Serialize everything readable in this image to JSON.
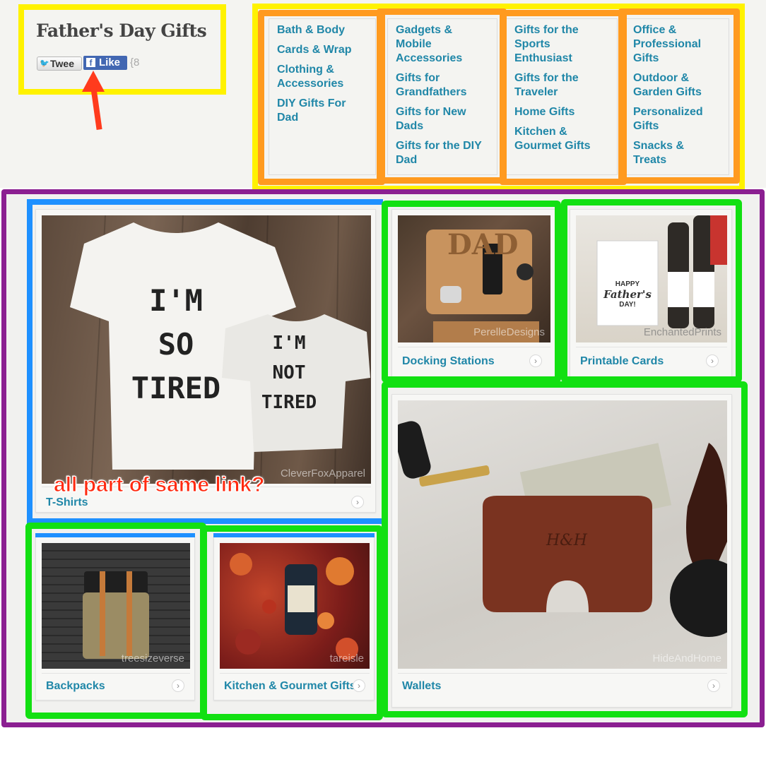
{
  "header": {
    "title": "Father's Day Gifts",
    "tweet_label": "Twee",
    "like_label": "Like",
    "share_count": "{8"
  },
  "categories": {
    "columns": [
      [
        "Bath & Body",
        "Cards & Wrap",
        "Clothing & Accessories",
        "DIY Gifts For Dad"
      ],
      [
        "Gadgets & Mobile Accessories",
        "Gifts for Grandfathers",
        "Gifts for New Dads",
        "Gifts for the DIY Dad"
      ],
      [
        "Gifts for the Sports Enthusiast",
        "Gifts for the Traveler",
        "Home Gifts",
        "Kitchen & Gourmet Gifts"
      ],
      [
        "Office & Professional Gifts",
        "Outdoor & Garden Gifts",
        "Personalized Gifts",
        "Snacks & Treats"
      ]
    ]
  },
  "tiles": {
    "tshirts": {
      "label": "T-Shirts",
      "credit": "CleverFoxApparel",
      "shirt_text": "I'M SO TIRED",
      "onesie_text": "I'M NOT TIRED"
    },
    "docking": {
      "label": "Docking Stations",
      "credit": "PerelleDesigns",
      "stand_text": "DAD"
    },
    "cards": {
      "label": "Printable Cards",
      "credit": "EnchantedPrints",
      "card_line1": "HAPPY",
      "card_line2": "Father's",
      "card_line3": "DAY!"
    },
    "wallets": {
      "label": "Wallets",
      "credit": "HideAndHome",
      "monogram": "H&H"
    },
    "backpacks": {
      "label": "Backpacks",
      "credit": "treesizeverse"
    },
    "kitchen": {
      "label": "Kitchen & Gourmet Gifts",
      "credit": "tareisle"
    }
  },
  "annotation": {
    "text": "all part of same link?",
    "colors": {
      "yellow": "#fff200",
      "orange": "#ff9a1f",
      "purple": "#8b1f91",
      "blue": "#1e90ff",
      "green": "#12e012",
      "red": "#ff2a10"
    }
  },
  "icons": [
    "twitter-icon",
    "facebook-icon",
    "chevron-right-icon",
    "arrow-annotation-icon"
  ]
}
